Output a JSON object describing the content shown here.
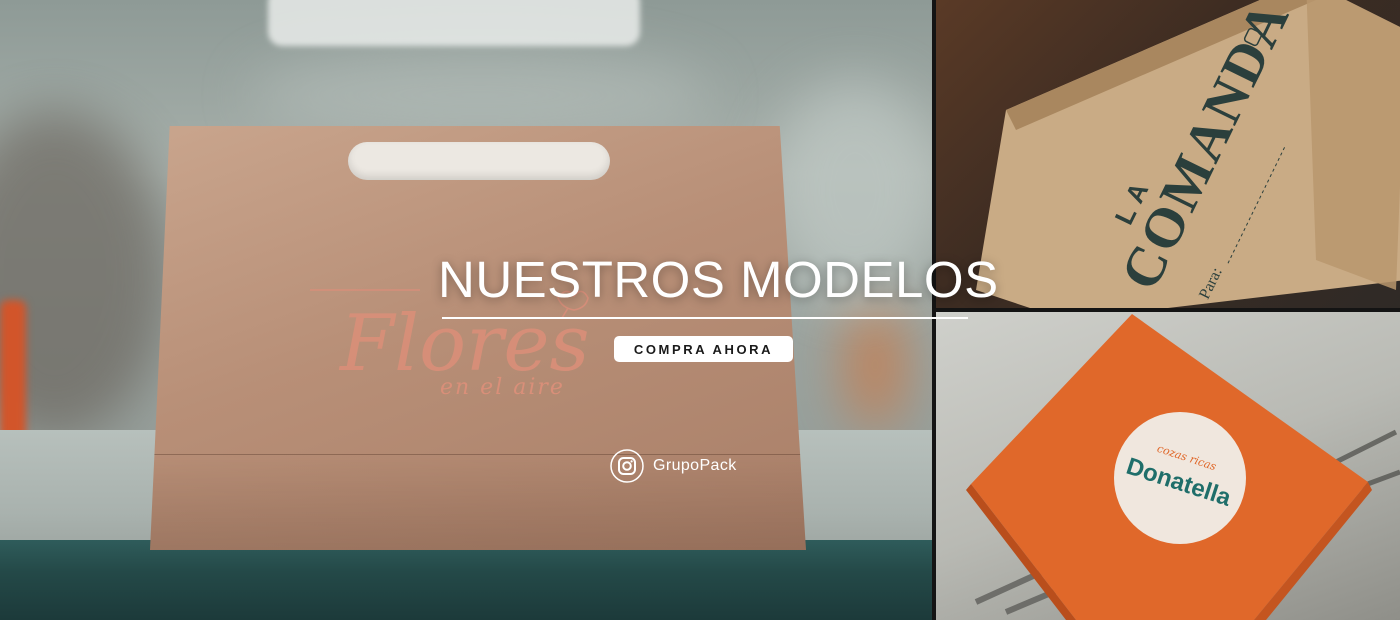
{
  "hero": {
    "title": "NUESTROS MODELOS",
    "cta_label": "COMPRA AHORA"
  },
  "social": {
    "icon": "instagram-icon",
    "handle": "GrupoPack"
  },
  "products": {
    "bag_brand_line1": "Flores",
    "bag_brand_line2": "en el aire",
    "kraft_box_brand_top": "LA",
    "kraft_box_brand_main": "COMANDA",
    "kraft_box_para": "Para:",
    "orange_box_brand": "Donatella",
    "orange_box_brand_tag": "cozas ricas"
  },
  "colors": {
    "accent_text": "#ffffff",
    "cta_background": "#ffffff",
    "orange_box": "#e0682a",
    "kraft": "#c9ab85",
    "comanda_ink": "#2b3f3c",
    "donatella_teal": "#1f6e6a"
  }
}
